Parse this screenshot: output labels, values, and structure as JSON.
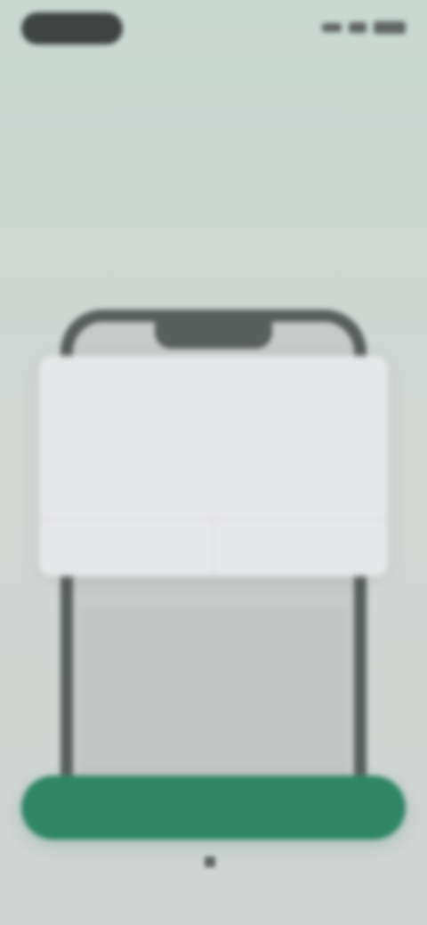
{
  "status_bar": {
    "icons": [
      "signal-icon",
      "wifi-icon",
      "battery-icon"
    ]
  },
  "header": {
    "skip_label": "",
    "title": ""
  },
  "instructions": {
    "step_1_prefix": "",
    "step_1_emphasis": "",
    "step_2_prefix": "",
    "step_2_emphasis": "",
    "step_2_suffix": ""
  },
  "dialog": {
    "title": "",
    "body": "",
    "link_text": "",
    "buttons": [
      "",
      ""
    ]
  },
  "primary_button": {
    "label": ""
  },
  "footer": {
    "note": "",
    "icon": "lock-icon"
  },
  "colors": {
    "accent": "#2f8566",
    "background": "#cdd6d2"
  }
}
